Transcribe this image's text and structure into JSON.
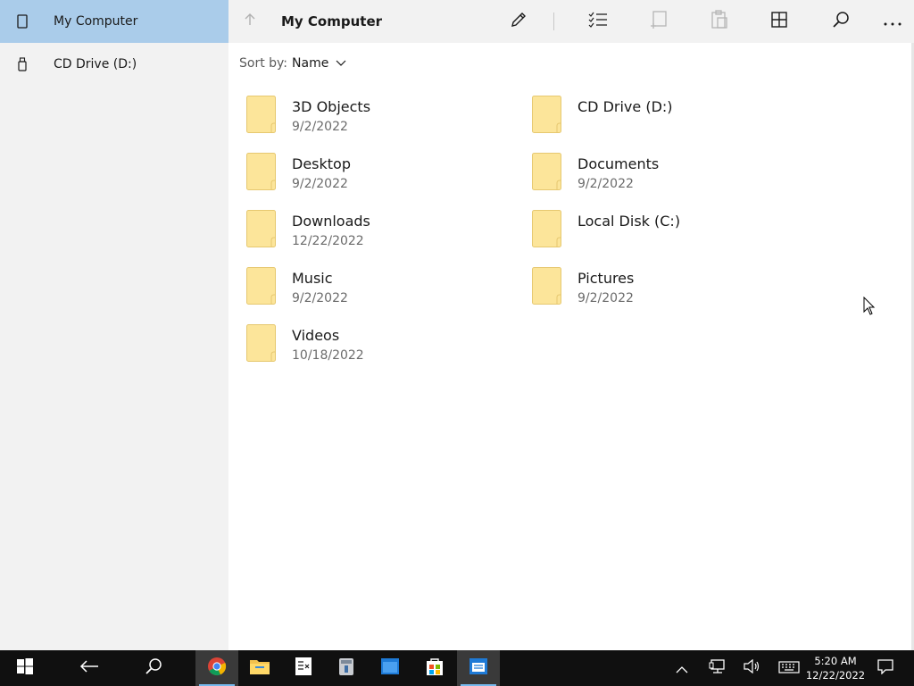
{
  "sidebar": {
    "items": [
      {
        "label": "My Computer",
        "icon": "phone-device-icon",
        "active": true
      },
      {
        "label": "CD Drive (D:)",
        "icon": "usb-drive-icon",
        "active": false
      }
    ]
  },
  "toolbar": {
    "title": "My Computer",
    "buttons": [
      "up-arrow-icon",
      "pencil-icon",
      "select-list-icon",
      "crop-icon",
      "paste-icon",
      "grid-view-icon",
      "search-icon",
      "more-icon"
    ]
  },
  "sort": {
    "label": "Sort by:",
    "value": "Name"
  },
  "files": [
    {
      "name": "3D Objects",
      "date": "9/2/2022"
    },
    {
      "name": "CD Drive (D:)",
      "date": ""
    },
    {
      "name": "Desktop",
      "date": "9/2/2022"
    },
    {
      "name": "Documents",
      "date": "9/2/2022"
    },
    {
      "name": "Downloads",
      "date": "12/22/2022"
    },
    {
      "name": "Local Disk (C:)",
      "date": ""
    },
    {
      "name": "Music",
      "date": "9/2/2022"
    },
    {
      "name": "Pictures",
      "date": "9/2/2022"
    },
    {
      "name": "Videos",
      "date": "10/18/2022"
    }
  ],
  "taskbar": {
    "apps": [
      "windows-start-icon",
      "back-arrow-icon",
      "search-icon",
      "chrome-icon",
      "file-explorer-icon",
      "notes-icon",
      "archive-icon",
      "window-icon",
      "store-icon",
      "files-app-icon"
    ],
    "tray": [
      "chevron-up-icon",
      "network-icon",
      "volume-icon",
      "keyboard-icon",
      "notification-icon"
    ],
    "time": "5:20 AM",
    "date": "12/22/2022"
  },
  "colors": {
    "sidebar_bg": "#f2f2f2",
    "selected": "#aaccea",
    "folder": "#fce59a",
    "taskbar": "#101010"
  }
}
